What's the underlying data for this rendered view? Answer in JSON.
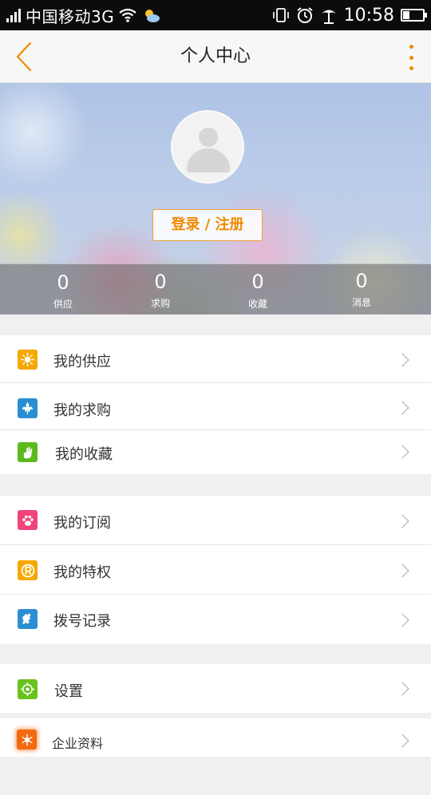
{
  "status_bar": {
    "carrier": "中国移动3G",
    "time": "10:58",
    "icons": [
      "signal-icon",
      "wifi-icon",
      "weather-icon",
      "vibrate-icon",
      "alarm-icon",
      "beach-icon",
      "battery-icon"
    ]
  },
  "nav": {
    "title": "个人中心",
    "back_icon": "chevron-left-icon",
    "more_icon": "more-vertical-icon",
    "accent": "#f08a00"
  },
  "profile": {
    "login_label": "登录 / 注册",
    "stats": [
      {
        "value": "0",
        "label": "供应"
      },
      {
        "value": "0",
        "label": "求购"
      },
      {
        "value": "0",
        "label": "收藏"
      },
      {
        "value": "0",
        "label": "消息"
      }
    ]
  },
  "menu": {
    "group1": [
      {
        "label": "我的供应",
        "icon": "sun-icon",
        "color": "#f5a800"
      },
      {
        "label": "我的求购",
        "icon": "fleur-de-lis-icon",
        "color": "#2a8fd2"
      },
      {
        "label": "我的收藏",
        "icon": "hand-icon",
        "color": "#5cba1e"
      }
    ],
    "group2": [
      {
        "label": "我的订阅",
        "icon": "paw-icon",
        "color": "#f0447a"
      },
      {
        "label": "我的特权",
        "icon": "registered-icon",
        "color": "#f5a800"
      },
      {
        "label": "拨号记录",
        "icon": "puzzle-icon",
        "color": "#2a8fd2"
      }
    ],
    "group3": [
      {
        "label": "设置",
        "icon": "target-icon",
        "color": "#6ac21c"
      }
    ],
    "group4": [
      {
        "label": "企业资料",
        "icon": "snowflake-icon",
        "color": "#f26a10"
      }
    ]
  }
}
